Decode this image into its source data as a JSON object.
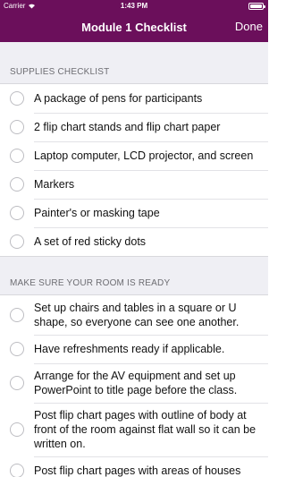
{
  "status_bar": {
    "carrier": "Carrier",
    "time": "1:43 PM"
  },
  "nav": {
    "title": "Module 1 Checklist",
    "done_label": "Done"
  },
  "sections": [
    {
      "header": "SUPPLIES CHECKLIST",
      "items": [
        "A package of pens for participants",
        "2 flip chart stands and flip chart paper",
        "Laptop computer, LCD projector, and screen",
        "Markers",
        "Painter's or masking tape",
        "A set of red sticky dots"
      ]
    },
    {
      "header": "MAKE SURE YOUR ROOM IS READY",
      "items": [
        "Set up chairs and tables in a square or U shape, so everyone can see one another.",
        "Have refreshments ready if applicable.",
        "Arrange for the AV equipment and set up PowerPoint to title page before the class.",
        "Post flip chart pages with outline of body at front of the room against flat wall so it can be written on.",
        "Post flip chart pages with areas of houses"
      ]
    }
  ]
}
